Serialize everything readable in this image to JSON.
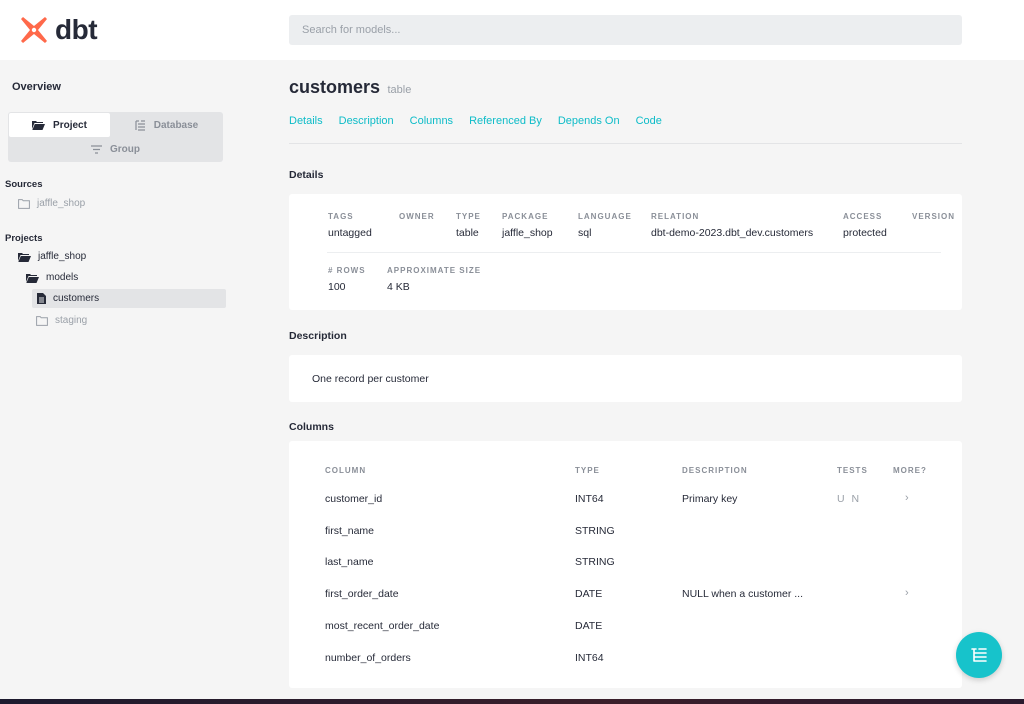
{
  "header": {
    "brand": "dbt",
    "brand_color": "#ff694a",
    "search_placeholder": "Search for models..."
  },
  "sidebar": {
    "overview_title": "Overview",
    "tabs": {
      "project": "Project",
      "database": "Database",
      "group": "Group"
    },
    "sources": {
      "heading": "Sources",
      "items": [
        {
          "label": "jaffle_shop",
          "icon": "folder-icon"
        }
      ]
    },
    "projects": {
      "heading": "Projects",
      "root": "jaffle_shop",
      "models_folder": "models",
      "active_item": "customers",
      "staging_folder": "staging"
    }
  },
  "main": {
    "title": "customers",
    "title_type": "table",
    "tabs": [
      "Details",
      "Description",
      "Columns",
      "Referenced By",
      "Depends On",
      "Code"
    ],
    "accent_color": "#0dbcc8",
    "details": {
      "section_title": "Details",
      "fields": [
        {
          "label": "TAGS",
          "value": "untagged"
        },
        {
          "label": "OWNER",
          "value": ""
        },
        {
          "label": "TYPE",
          "value": "table"
        },
        {
          "label": "PACKAGE",
          "value": "jaffle_shop"
        },
        {
          "label": "LANGUAGE",
          "value": "sql"
        },
        {
          "label": "RELATION",
          "value": "dbt-demo-2023.dbt_dev.customers"
        },
        {
          "label": "ACCESS",
          "value": "protected"
        },
        {
          "label": "VERSION",
          "value": ""
        }
      ],
      "stats": [
        {
          "label": "# ROWS",
          "value": "100"
        },
        {
          "label": "APPROXIMATE SIZE",
          "value": "4 KB"
        }
      ]
    },
    "description": {
      "section_title": "Description",
      "text": "One record per customer"
    },
    "columns": {
      "section_title": "Columns",
      "headers": {
        "column": "COLUMN",
        "type": "TYPE",
        "description": "DESCRIPTION",
        "tests": "TESTS",
        "more": "MORE?"
      },
      "rows": [
        {
          "name": "customer_id",
          "type": "INT64",
          "description": "Primary key",
          "tests": "U N",
          "more": "›"
        },
        {
          "name": "first_name",
          "type": "STRING",
          "description": "",
          "tests": "",
          "more": ""
        },
        {
          "name": "last_name",
          "type": "STRING",
          "description": "",
          "tests": "",
          "more": ""
        },
        {
          "name": "first_order_date",
          "type": "DATE",
          "description": "NULL when a customer ...",
          "tests": "",
          "more": "›"
        },
        {
          "name": "most_recent_order_date",
          "type": "DATE",
          "description": "",
          "tests": "",
          "more": ""
        },
        {
          "name": "number_of_orders",
          "type": "INT64",
          "description": "",
          "tests": "",
          "more": ""
        }
      ]
    }
  },
  "fab": {
    "icon": "lineage-graph-icon",
    "color": "#17c3cb"
  }
}
